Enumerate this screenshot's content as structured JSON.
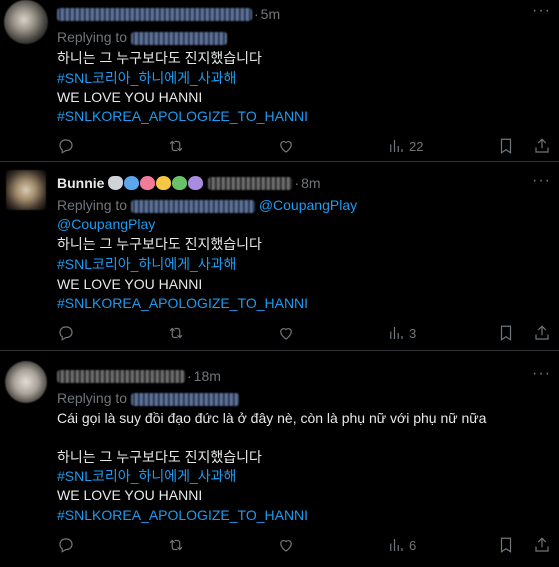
{
  "tweets": [
    {
      "time": "5m",
      "replying_prefix": "Replying to",
      "lines": [
        "하니는 그 누구보다도 진지했습니다",
        "#SNL코리아_하니에게_사과해",
        "WE LOVE YOU HANNI",
        "#SNLKOREA_APOLOGIZE_TO_HANNI"
      ],
      "views": "22"
    },
    {
      "name": "Bunnie",
      "time": "8m",
      "replying_prefix": "Replying to",
      "mention1": "@CoupangPlay",
      "mention2": "@CoupangPlay",
      "lines": [
        "하니는 그 누구보다도 진지했습니다",
        "#SNL코리아_하니에게_사과해",
        "WE LOVE YOU HANNI",
        "#SNLKOREA_APOLOGIZE_TO_HANNI"
      ],
      "views": "3"
    },
    {
      "time": "18m",
      "replying_prefix": "Replying to",
      "vi_line": "Cái gọi là suy đồi đạo đức là ở đây nè, còn là phụ nữ với phụ nữ nữa",
      "lines": [
        "하니는 그 누구보다도 진지했습니다",
        "#SNL코리아_하니에게_사과해",
        "WE LOVE YOU HANNI",
        "#SNLKOREA_APOLOGIZE_TO_HANNI"
      ],
      "views": "6"
    }
  ],
  "icons": [
    "reply-icon",
    "retweet-icon",
    "like-icon",
    "views-icon",
    "bookmark-icon",
    "share-icon",
    "more-icon"
  ],
  "colors": {
    "background": "#000000",
    "text": "#e7e9ea",
    "muted": "#71767b",
    "link": "#1d9bf0",
    "divider": "#2f3336"
  }
}
